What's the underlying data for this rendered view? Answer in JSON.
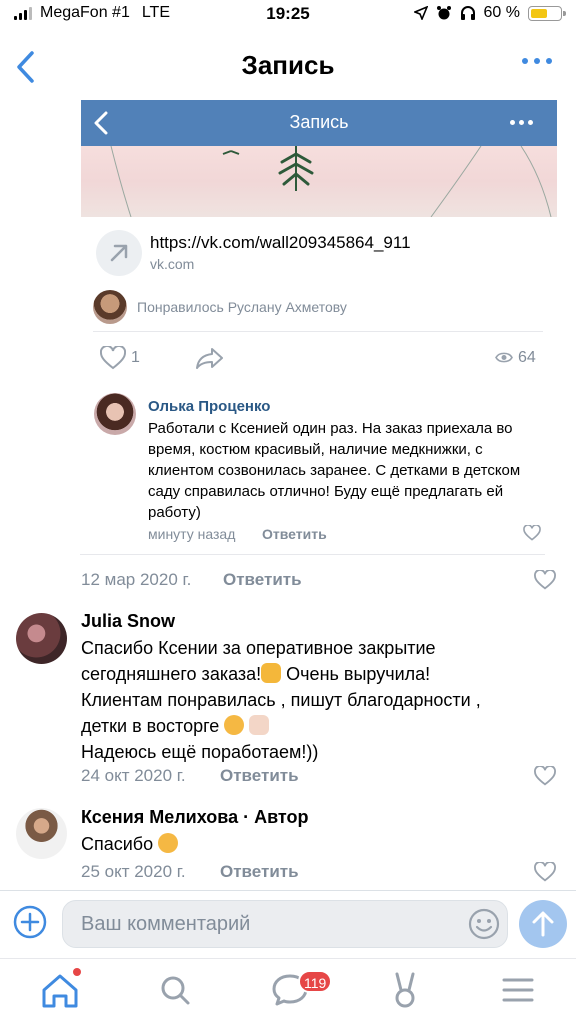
{
  "status_bar": {
    "carrier": "MegaFon #1",
    "network": "LTE",
    "time": "19:25",
    "battery": "60 %",
    "battery_level": 0.6
  },
  "nav": {
    "title": "Запись"
  },
  "embed": {
    "header_title": "Запись",
    "link_url": "https://vk.com/wall209345864_911",
    "link_domain": "vk.com",
    "liked_by": "Понравилось Руслану Ахметову",
    "likes": "1",
    "views": "64",
    "comment": {
      "author": "Олька Проценко",
      "text": "Работали с Ксенией один раз. На заказ приехала во время, костюм красивый, наличие медкнижки, с клиентом созвонилась заранее. С детками в детском саду справилась отлично! Буду ещё предлагать ей работу)",
      "time": "минуту назад",
      "reply": "Ответить"
    }
  },
  "post_meta": {
    "date": "12 мар 2020 г.",
    "reply": "Ответить"
  },
  "comments": [
    {
      "author": "Julia Snow",
      "line1": "Спасибо Ксении за оперативное закрытие",
      "line2": "сегодняшнего заказа!",
      "line2b": " Очень выручила!",
      "line3": "Клиентам понравилась , пишут благодарности ,",
      "line4": "детки в восторге ",
      "line5": "Надеюсь ещё поработаем!))",
      "date": "24 окт 2020 г.",
      "reply": "Ответить"
    },
    {
      "author": "Ксения Мелихова · Автор",
      "text": "Спасибо ",
      "date": "25 окт 2020 г.",
      "reply": "Ответить"
    }
  ],
  "input": {
    "placeholder": "Ваш комментарий"
  },
  "tabbar": {
    "messages_badge": "119"
  },
  "colors": {
    "accent": "#3f8ae0",
    "vk_header": "#5181b8",
    "badge": "#e64646",
    "link_author": "#2a5885"
  }
}
